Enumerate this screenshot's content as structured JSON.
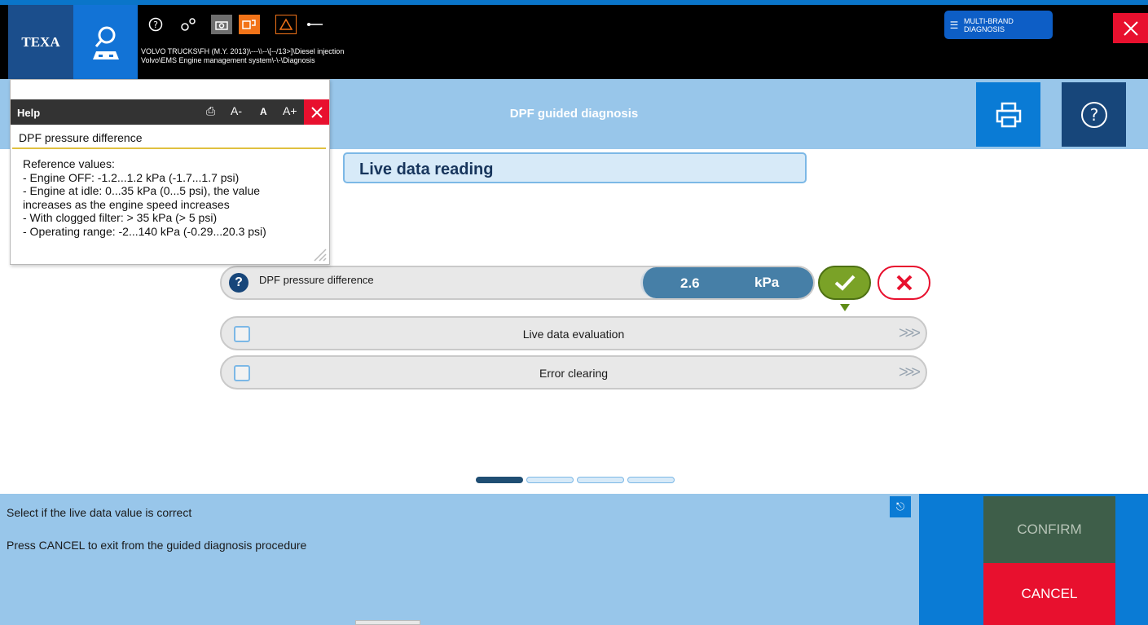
{
  "topbar": {
    "logo_text": "TEXA",
    "path_line1": "VOLVO TRUCKS\\FH (M.Y. 2013)\\---\\\\--\\[--/13>]\\Diesel injection",
    "path_line2": "Volvo\\EMS Engine management system\\-\\-\\Diagnosis",
    "multibrand_line1": "MULTI-BRAND",
    "multibrand_line2": "DIAGNOSIS",
    "icons": [
      "search-car-icon",
      "help-icon",
      "settings-icon",
      "screenshot-icon",
      "vehicle-connect-icon",
      "warning-icon",
      "usb-icon"
    ]
  },
  "title": "DPF guided diagnosis",
  "section_title": "Live data reading",
  "live_data": {
    "label": "DPF pressure difference",
    "value": "2.6",
    "unit": "kPa"
  },
  "steps": [
    {
      "label": "Live data evaluation"
    },
    {
      "label": "Error clearing"
    }
  ],
  "bottom": {
    "message1": "Select if the live data value is correct",
    "message2": "Press CANCEL to exit from the guided diagnosis procedure",
    "confirm_label": "CONFIRM",
    "cancel_label": "CANCEL"
  },
  "help_panel": {
    "title": "Help",
    "heading": "DPF pressure difference",
    "font_decrease": "A-",
    "font_reset": "A",
    "font_increase": "A+",
    "body_lines": [
      "Reference values:",
      "- Engine OFF: -1.2...1.2 kPa (-1.7...1.7 psi)",
      "- Engine at idle: 0...35 kPa (0...5 psi), the value",
      "increases as the engine speed increases",
      "- With clogged filter: > 35 kPa (> 5 psi)",
      "- Operating range: -2...140 kPa (-0.29...20.3 psi)"
    ]
  },
  "progress": {
    "current_step": 1,
    "total_steps": 4
  },
  "colors": {
    "accent": "#0a7bd5",
    "panel": "#98c6ea",
    "ok": "#7aa227",
    "error": "#e8102e",
    "confirm": "#3e5e49"
  }
}
